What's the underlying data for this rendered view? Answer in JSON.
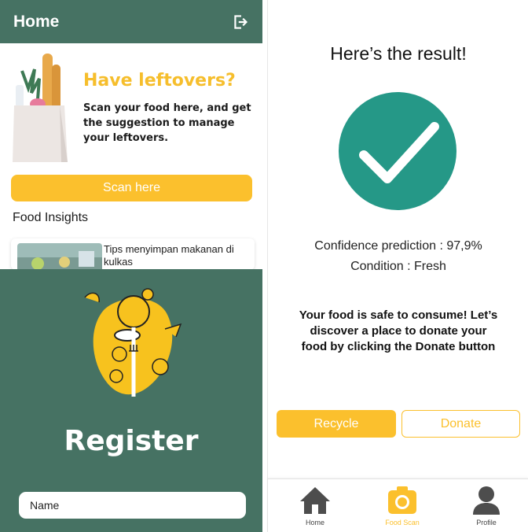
{
  "home": {
    "title": "Home",
    "hero_heading": "Have leftovers?",
    "hero_description": "Scan your food here, and get the suggestion to manage your leftovers.",
    "scan_button": "Scan here",
    "insights_title": "Food Insights",
    "insight_card_title": "Tips menyimpan makanan di kulkas"
  },
  "register": {
    "title": "Register",
    "name_placeholder": "Name"
  },
  "result": {
    "title": "Here’s the result!",
    "confidence": "Confidence prediction : 97,9%",
    "condition": "Condition : Fresh",
    "message": "Your food is safe to consume! Let’s discover a place to donate your food by clicking the Donate button",
    "recycle_button": "Recycle",
    "donate_button": "Donate"
  },
  "nav": {
    "home": "Home",
    "food_scan": "Food Scan",
    "profile": "Profile"
  },
  "colors": {
    "primary_green": "#467263",
    "accent_yellow": "#FBC02D",
    "check_teal": "#259887"
  },
  "icons": [
    "logout-icon",
    "check-icon",
    "home-icon",
    "camera-icon",
    "profile-icon"
  ]
}
